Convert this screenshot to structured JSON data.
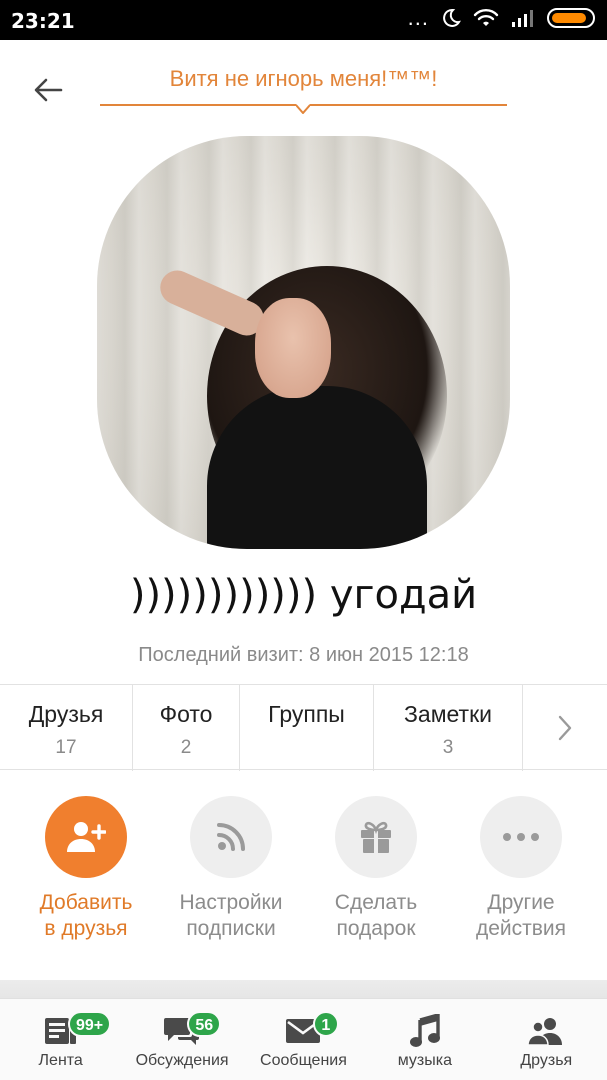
{
  "statusbar": {
    "time": "23:21",
    "dots": "...",
    "icons": [
      "moon-icon",
      "wifi-icon",
      "signal-icon",
      "battery-icon"
    ]
  },
  "header": {
    "status_message": "Витя не игнорь меня!™™!"
  },
  "profile": {
    "name": ")))))))))))) угодай",
    "last_visit": "Последний визит: 8 июн 2015 12:18"
  },
  "stats": [
    {
      "label": "Друзья",
      "count": "17"
    },
    {
      "label": "Фото",
      "count": "2"
    },
    {
      "label": "Группы",
      "count": ""
    },
    {
      "label": "Заметки",
      "count": "3"
    }
  ],
  "actions": [
    {
      "line1": "Добавить",
      "line2": "в друзья",
      "icon": "add-friend-icon"
    },
    {
      "line1": "Настройки",
      "line2": "подписки",
      "icon": "rss-icon"
    },
    {
      "line1": "Сделать",
      "line2": "подарок",
      "icon": "gift-icon"
    },
    {
      "line1": "Другие",
      "line2": "действия",
      "icon": "more-dots-icon"
    }
  ],
  "bottom_nav": [
    {
      "label": "Лента",
      "badge": "99+",
      "icon": "feed-icon"
    },
    {
      "label": "Обсуждения",
      "badge": "56",
      "icon": "discussions-icon"
    },
    {
      "label": "Сообщения",
      "badge": "1",
      "icon": "messages-icon"
    },
    {
      "label": "музыка",
      "badge": "",
      "icon": "music-icon"
    },
    {
      "label": "Друзья",
      "badge": "",
      "icon": "friends-icon"
    }
  ],
  "colors": {
    "accent": "#f07f2e",
    "badge": "#2ea54a",
    "muted": "#8a8a8a"
  }
}
